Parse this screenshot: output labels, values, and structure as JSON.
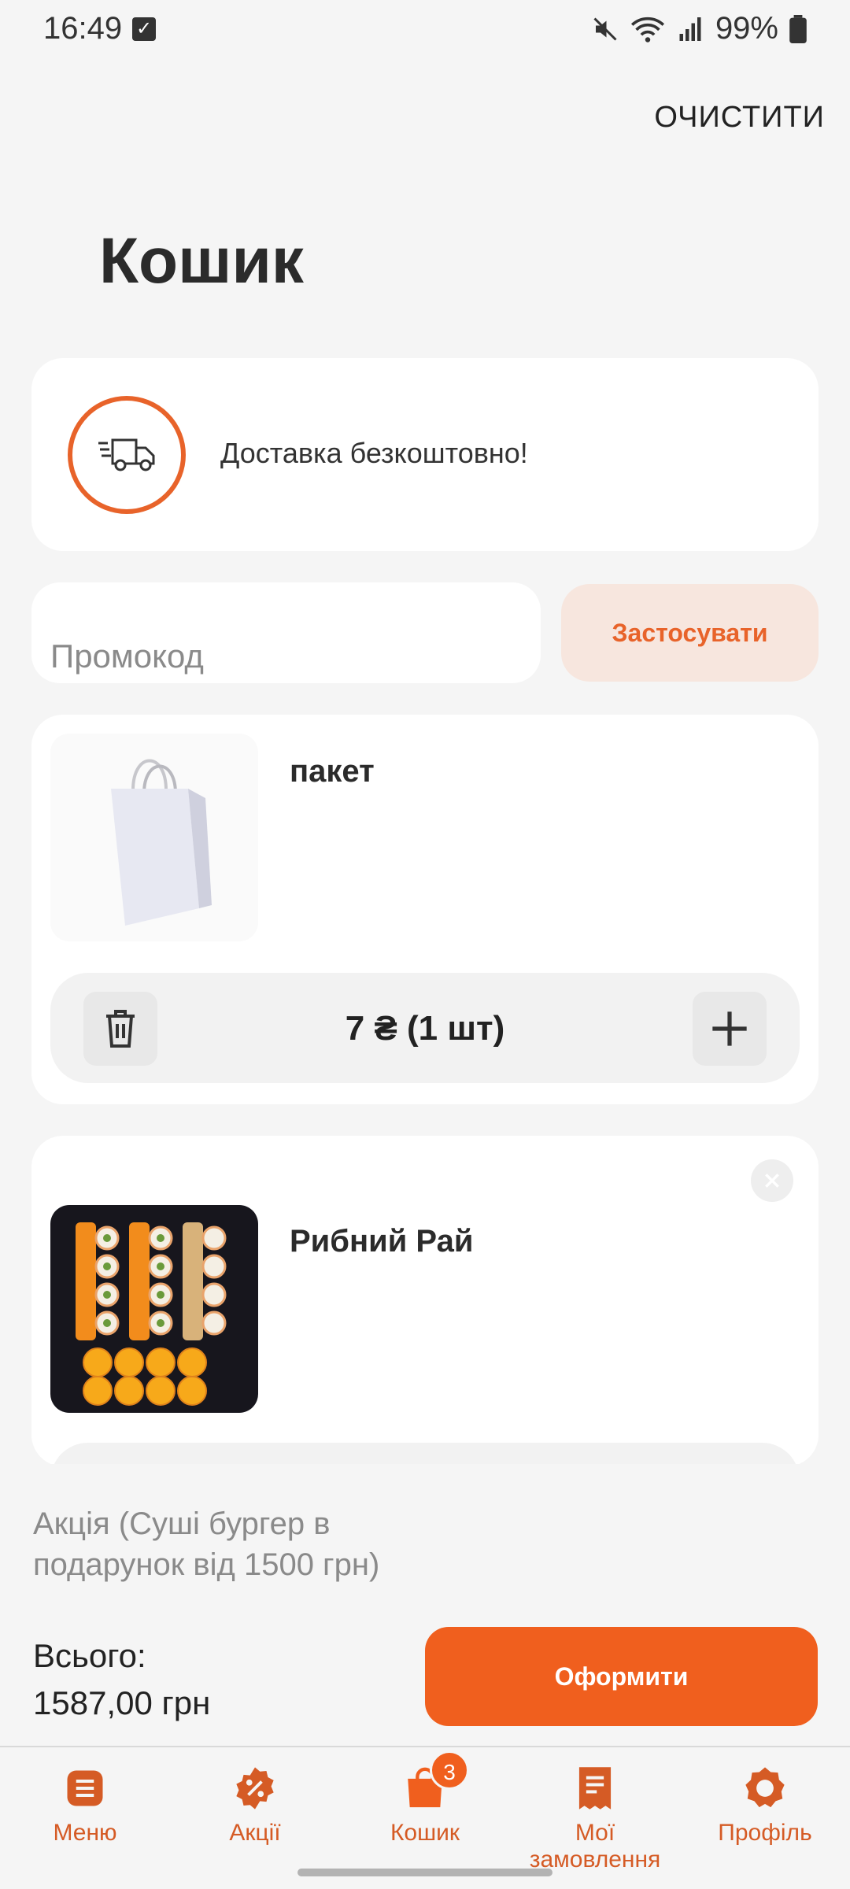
{
  "status_bar": {
    "time": "16:49",
    "battery": "99%"
  },
  "header": {
    "clear_label": "ОЧИСТИТИ",
    "title": "Кошик"
  },
  "delivery": {
    "icon": "delivery-truck-icon",
    "text": "Доставка безкоштовно!"
  },
  "promo": {
    "placeholder": "Промокод",
    "value": "",
    "apply_label": "Застосувати"
  },
  "cart_items": [
    {
      "name": "пакет",
      "price_qty": "7 ₴ (1 шт)"
    },
    {
      "name": "Рибний Рай"
    }
  ],
  "summary": {
    "promo_note": "Акція (Суші бургер в подарунок від 1500 грн)",
    "total_label": "Всього:",
    "total_value": "1587,00 грн",
    "checkout_label": "Оформити"
  },
  "nav": {
    "items": [
      {
        "label": "Меню",
        "icon": "menu-icon"
      },
      {
        "label": "Акції",
        "icon": "discount-icon"
      },
      {
        "label": "Кошик",
        "icon": "cart-icon",
        "badge": "3",
        "active": true
      },
      {
        "label": "Мої замовлення",
        "icon": "orders-icon"
      },
      {
        "label": "Профіль",
        "icon": "profile-icon"
      }
    ]
  },
  "colors": {
    "accent": "#f05f1e",
    "accent_soft": "#f7e6de",
    "background": "#f5f5f5"
  }
}
